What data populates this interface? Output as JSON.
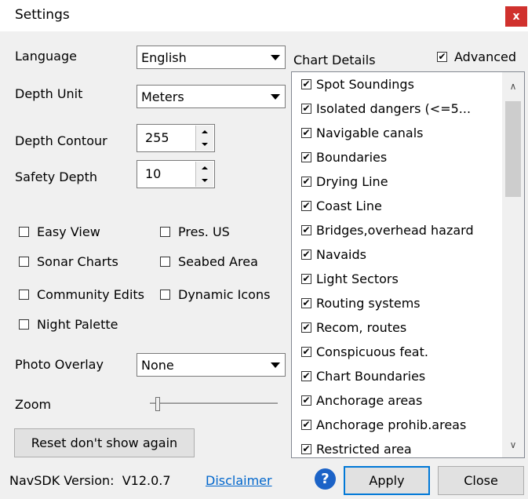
{
  "window": {
    "title": "Settings",
    "close_glyph": "x"
  },
  "language": {
    "label": "Language",
    "value": "English"
  },
  "depth_unit": {
    "label": "Depth Unit",
    "value": "Meters"
  },
  "depth_contour": {
    "label": "Depth Contour",
    "value": "255"
  },
  "safety_depth": {
    "label": "Safety Depth",
    "value": "10"
  },
  "options": [
    {
      "label": "Easy View",
      "checked": false
    },
    {
      "label": "Pres. US",
      "checked": false
    },
    {
      "label": "Sonar Charts",
      "checked": false
    },
    {
      "label": "Seabed Area",
      "checked": false
    },
    {
      "label": "Community Edits",
      "checked": false
    },
    {
      "label": "Dynamic Icons",
      "checked": false
    },
    {
      "label": "Night Palette",
      "checked": false
    }
  ],
  "photo_overlay": {
    "label": "Photo Overlay",
    "value": "None"
  },
  "zoom": {
    "label": "Zoom",
    "level": 0.05
  },
  "reset_button": "Reset don't show again",
  "chart_details": {
    "label": "Chart Details",
    "advanced": {
      "label": "Advanced",
      "checked": true
    },
    "items": [
      {
        "label": "Spot Soundings",
        "checked": true
      },
      {
        "label": "Isolated dangers (<=5...",
        "checked": true
      },
      {
        "label": "Navigable canals",
        "checked": true
      },
      {
        "label": "Boundaries",
        "checked": true
      },
      {
        "label": "Drying Line",
        "checked": true
      },
      {
        "label": "Coast Line",
        "checked": true
      },
      {
        "label": "Bridges,overhead hazard",
        "checked": true
      },
      {
        "label": "Navaids",
        "checked": true
      },
      {
        "label": "Light Sectors",
        "checked": true
      },
      {
        "label": "Routing systems",
        "checked": true
      },
      {
        "label": "Recom, routes",
        "checked": true
      },
      {
        "label": "Conspicuous feat.",
        "checked": true
      },
      {
        "label": "Chart Boundaries",
        "checked": true
      },
      {
        "label": "Anchorage areas",
        "checked": true
      },
      {
        "label": "Anchorage prohib.areas",
        "checked": true
      },
      {
        "label": "Restricted area",
        "checked": true
      }
    ]
  },
  "footer": {
    "version": "NavSDK Version:  V12.0.7",
    "disclaimer": "Disclaimer",
    "help_glyph": "?",
    "apply": "Apply",
    "close": "Close"
  },
  "colors": {
    "accent": "#0078d7",
    "close": "#d0312d",
    "link": "#0066cc",
    "help": "#1c63c7"
  },
  "icons": {
    "check": "✔",
    "scroll_up": "∧",
    "scroll_down": "∨"
  }
}
